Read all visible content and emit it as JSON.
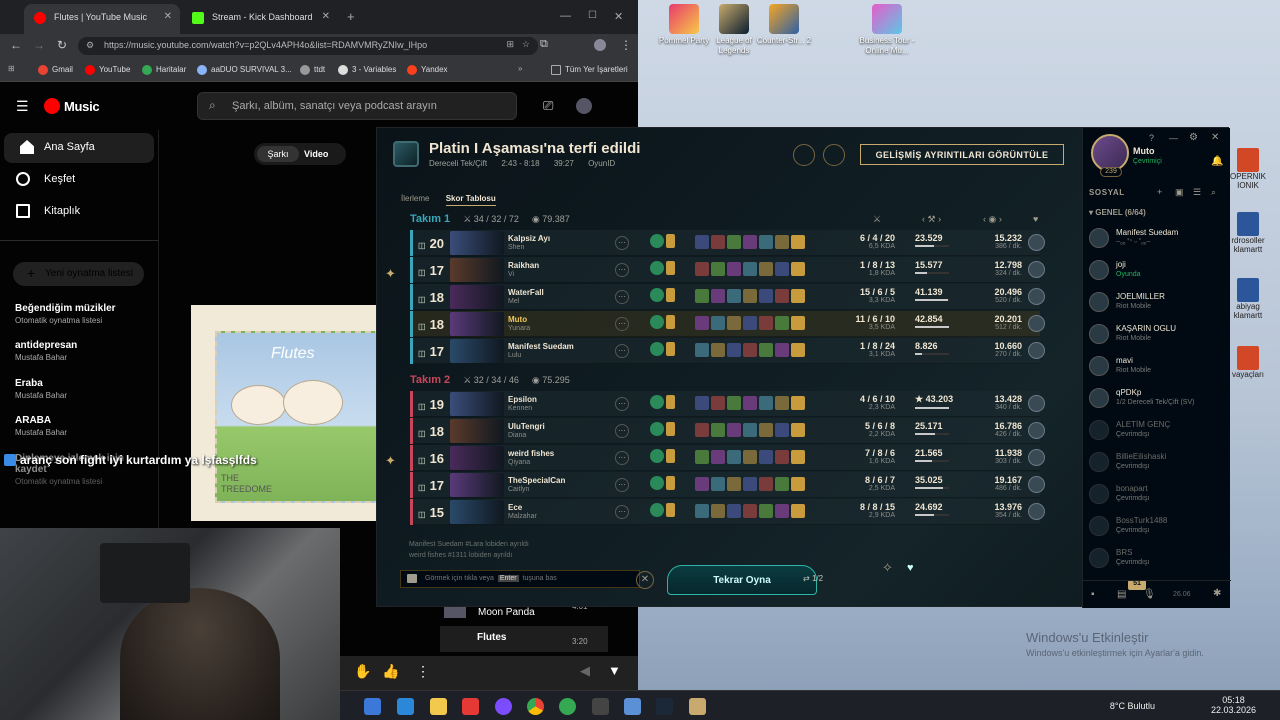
{
  "desktop": {
    "icons": [
      {
        "label": "Pommel Party"
      },
      {
        "label": "League of Legends"
      },
      {
        "label": "Counter-Str... 2"
      },
      {
        "label": "Business Tour - Online Mu..."
      }
    ],
    "right_icons": [
      {
        "label": "OPERNIK IONIK"
      },
      {
        "label": "rdrosoller klamartt"
      },
      {
        "label": "abiyag klamartt"
      },
      {
        "label": "vayaçları"
      }
    ],
    "activate_title": "Windows'u Etkinleştir",
    "activate_sub": "Windows'u etkinleştirmek için Ayarlar'a gidin."
  },
  "taskbar": {
    "weather": "8°C  Bulutlu",
    "time": "05:18",
    "date": "22.03.2026"
  },
  "browser": {
    "tabs": [
      {
        "title": "Flutes | YouTube Music"
      },
      {
        "title": "Stream - Kick Dashboard"
      }
    ],
    "new_tab": "+",
    "url": "https://music.youtube.com/watch?v=p2QLv4APH4o&list=RDAMVMRyZNIw_lHpo",
    "bookmarks": [
      "Gmail",
      "YouTube",
      "Haritalar",
      "aaDUO SURVIVAL 3...",
      "ttdt",
      "3 - Variables",
      "Yandex",
      "Tüm Yer İşaretleri"
    ],
    "colors": {
      "accent": "#ff0000"
    }
  },
  "ytm": {
    "logo": "Music",
    "search_placeholder": "Şarkı, albüm, sanatçı veya podcast arayın",
    "nav": [
      {
        "label": "Ana Sayfa"
      },
      {
        "label": "Keşfet"
      },
      {
        "label": "Kitaplık"
      }
    ],
    "new_playlist": "Yeni oynatma listesi",
    "playlists": [
      {
        "title": "Beğendiğim müzikler",
        "sub": "Otomatik oynatma listesi"
      },
      {
        "title": "antidepresan",
        "sub": "Mustafa Bahar"
      },
      {
        "title": "Eraba",
        "sub": "Mustafa Bahar"
      },
      {
        "title": "ARABA",
        "sub": "Mustafa Bahar"
      },
      {
        "title": "Dinlemeye izlemek için kaydet",
        "sub": "Otomatik oynatma listesi"
      }
    ],
    "switch_song": "Şarkı",
    "switch_video": "Video",
    "album_title": "Flutes",
    "album_caption": "THE TREEDOME",
    "overlay_text": "aranç son fight iyi kurtardım ya lşfasşlfds",
    "queue": [
      {
        "title": "Moon Panda",
        "duration": "4:01"
      },
      {
        "title": "Flutes",
        "duration": "3:20"
      }
    ]
  },
  "lol": {
    "title": "Platin I Aşaması'na terfi edildi",
    "queue": "Dereceli Tek/Çift",
    "time_range": "2:43 - 8:18",
    "duration": "39:27",
    "game_id": "OyunID",
    "advanced_button": "GELİŞMİŞ AYRINTILARI GÖRÜNTÜLE",
    "tab_progress": "İlerleme",
    "tab_scoreboard": "Skor Tablosu",
    "team1": {
      "label": "Takım 1",
      "kda": "34 / 32 / 72",
      "gold": "79.387"
    },
    "team2": {
      "label": "Takım 2",
      "kda": "32 / 34 / 46",
      "gold": "75.295"
    },
    "players_team1": [
      {
        "level": "20",
        "name": "Kalpsiz Ayı",
        "champion": "Shen",
        "kda": "6 / 4 / 20",
        "kda_ratio": "6,5 KDA",
        "damage": "23.529",
        "damage_pct": 0.55,
        "gold": "15.232",
        "cs": "386 / dk."
      },
      {
        "level": "17",
        "name": "Raikhan",
        "champion": "Vi",
        "kda": "1 / 8 / 13",
        "kda_ratio": "1,8 KDA",
        "damage": "15.577",
        "damage_pct": 0.36,
        "gold": "12.798",
        "cs": "324 / dk."
      },
      {
        "level": "18",
        "name": "WaterFall",
        "champion": "Mel",
        "kda": "15 / 6 / 5",
        "kda_ratio": "3,3 KDA",
        "damage": "41.139",
        "damage_pct": 0.96,
        "gold": "20.496",
        "cs": "520 / dk."
      },
      {
        "level": "18",
        "name": "Muto",
        "champion": "Yunara",
        "kda": "11 / 6 / 10",
        "kda_ratio": "3,5 KDA",
        "damage": "42.854",
        "damage_pct": 1.0,
        "gold": "20.201",
        "cs": "512 / dk."
      },
      {
        "level": "17",
        "name": "Manifest Suedam",
        "champion": "Lulu",
        "kda": "1 / 8 / 24",
        "kda_ratio": "3,1 KDA",
        "damage": "8.826",
        "damage_pct": 0.21,
        "gold": "10.660",
        "cs": "270 / dk."
      }
    ],
    "players_team2": [
      {
        "level": "19",
        "name": "Epsilon",
        "champion": "Kennen",
        "kda": "4 / 6 / 10",
        "kda_ratio": "2,3 KDA",
        "damage": "★ 43.203",
        "damage_pct": 1.0,
        "gold": "13.428",
        "cs": "340 / dk."
      },
      {
        "level": "18",
        "name": "UluTengri",
        "champion": "Diana",
        "kda": "5 / 6 / 8",
        "kda_ratio": "2,2 KDA",
        "damage": "25.171",
        "damage_pct": 0.58,
        "gold": "16.786",
        "cs": "426 / dk."
      },
      {
        "level": "16",
        "name": "weird fishes",
        "champion": "Qiyana",
        "kda": "7 / 8 / 6",
        "kda_ratio": "1,6 KDA",
        "damage": "21.565",
        "damage_pct": 0.5,
        "gold": "11.938",
        "cs": "303 / dk."
      },
      {
        "level": "17",
        "name": "TheSpecialCan",
        "champion": "Caitlyn",
        "kda": "8 / 6 / 7",
        "kda_ratio": "2,5 KDA",
        "damage": "35.025",
        "damage_pct": 0.81,
        "gold": "19.167",
        "cs": "486 / dk."
      },
      {
        "level": "15",
        "name": "Ece",
        "champion": "Malzahar",
        "kda": "8 / 8 / 15",
        "kda_ratio": "2,9 KDA",
        "damage": "24.692",
        "damage_pct": 0.57,
        "gold": "13.976",
        "cs": "354 / dk."
      }
    ],
    "chat_log": [
      "Manifest Suedam #Lara lobiden ayrıldı",
      "weird fishes #1311 lobiden ayrıldı"
    ],
    "chat_placeholder_pre": "Görmek için tıkla veya",
    "chat_key": "Enter",
    "chat_placeholder_post": "tuşuna bas",
    "play_again": "Tekrar Oyna",
    "votes": "1/2",
    "colors": {
      "team1": "#3aa6b9",
      "team2": "#c8465a",
      "gold": "#c8aa6e",
      "me": "#f0c95b"
    }
  },
  "social": {
    "name": "Muto",
    "status": "Çevrimiçi",
    "level": "239",
    "title": "SOSYAL",
    "group": "GENEL (6/64)",
    "badge": "51",
    "friends": [
      {
        "name": "Manifest Suedam",
        "status": "~ₒₒ ˚ᵔ ᵕ ˚ₒₒ~",
        "state": "ingame"
      },
      {
        "name": "joji",
        "status": "Oyunda",
        "state": "online"
      },
      {
        "name": "JOELMILLER",
        "status": "Riot Mobile",
        "state": "mobile"
      },
      {
        "name": "KAŞARIN OGLU",
        "status": "Riot Mobile",
        "state": "mobile"
      },
      {
        "name": "mavi",
        "status": "Riot Mobile",
        "state": "mobile"
      },
      {
        "name": "qPDKp",
        "status": "1/2 Dereceli Tek/Çift (SV)",
        "state": "ingame"
      },
      {
        "name": "ALETİM GENÇ",
        "status": "Çevrimdışı",
        "state": "off"
      },
      {
        "name": "BillieEilishaski",
        "status": "Çevrimdışı",
        "state": "off"
      },
      {
        "name": "bonapart",
        "status": "Çevrimdışı",
        "state": "off"
      },
      {
        "name": "BossTurk1488",
        "status": "Çevrimdışı",
        "state": "off"
      },
      {
        "name": "BRS",
        "status": "Çevrimdışı",
        "state": "off"
      }
    ],
    "version": "26.06"
  }
}
